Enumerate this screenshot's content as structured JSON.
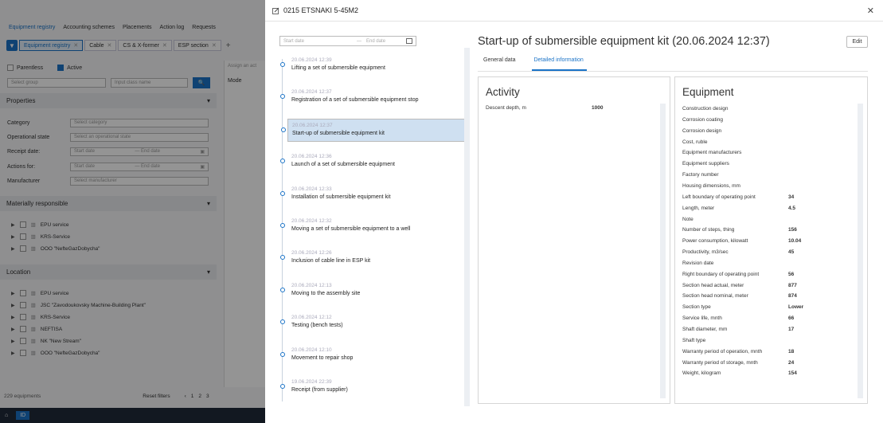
{
  "background": {
    "topnav": [
      "Equipment registry",
      "Accounting schemes",
      "Placements",
      "Action log",
      "Requests"
    ],
    "tabs": [
      {
        "label": "Equipment registry",
        "active": true
      },
      {
        "label": "Cable",
        "active": false
      },
      {
        "label": "CS & X-former",
        "active": false
      },
      {
        "label": "ESP section",
        "active": false
      }
    ],
    "checks": {
      "parentless": "Parentless",
      "active": "Active"
    },
    "select_group_placeholder": "Select group",
    "input_class_placeholder": "Input class name",
    "properties_title": "Properties",
    "props": [
      {
        "label": "Category",
        "placeholder": "Select category"
      },
      {
        "label": "Operational state",
        "placeholder": "Select an operational state"
      },
      {
        "label": "Receipt date:",
        "start": "Start date",
        "end": "End date"
      },
      {
        "label": "Actions for:",
        "start": "Start date",
        "end": "End date"
      },
      {
        "label": "Manufacturer",
        "placeholder": "Select manufacturer"
      }
    ],
    "materially_title": "Materially responsible",
    "materially": [
      "EPU service",
      "KRS-Service",
      "OOO \"NefteGazDobycha\""
    ],
    "location_title": "Location",
    "locations": [
      "EPU service",
      "JSC \"Zavodoukovsky Machine-Building Plant\"",
      "KRS-Service",
      "NEFTISA",
      "NK \"New Stream\"",
      "OOO \"NefteGazDobycha\""
    ],
    "assign_text": "Assign an act",
    "model_header": "Mode",
    "count": "229 equipments",
    "reset": "Reset filters",
    "pages": [
      "1",
      "2",
      "3"
    ],
    "taskbar_id": "ID"
  },
  "modal": {
    "title": "0215 ETSNAKI 5-45M2",
    "close": "✕",
    "date_start_placeholder": "Start date",
    "date_end_placeholder": "End date",
    "events": [
      {
        "date": "20.06.2024 12:39",
        "event": "Lifting a set of submersible equipment",
        "selected": false
      },
      {
        "date": "20.06.2024 12:37",
        "event": "Registration of a set of submersible equipment stop",
        "selected": false
      },
      {
        "date": "20.06.2024 12:37",
        "event": "Start-up of submersible equipment kit",
        "selected": true
      },
      {
        "date": "20.06.2024 12:36",
        "event": "Launch of a set of submersible equipment",
        "selected": false
      },
      {
        "date": "20.06.2024 12:33",
        "event": "Installation of submersible equipment kit",
        "selected": false
      },
      {
        "date": "20.06.2024 12:32",
        "event": "Moving a set of submersible equipment to a well",
        "selected": false
      },
      {
        "date": "20.06.2024 12:26",
        "event": "Inclusion of cable line in ESP kit",
        "selected": false
      },
      {
        "date": "20.06.2024 12:13",
        "event": "Moving to the assembly site",
        "selected": false
      },
      {
        "date": "20.06.2024 12:12",
        "event": "Testing (bench tests)",
        "selected": false
      },
      {
        "date": "20.06.2024 12:10",
        "event": "Movement to repair shop",
        "selected": false
      },
      {
        "date": "19.06.2024 22:39",
        "event": "Receipt (from supplier)",
        "selected": false
      }
    ],
    "detail_title": "Start-up of submersible equipment kit (20.06.2024 12:37)",
    "edit_label": "Edit",
    "tabs": [
      {
        "label": "General data",
        "active": false
      },
      {
        "label": "Detailed information",
        "active": true
      }
    ],
    "activity": {
      "title": "Activity",
      "rows": [
        {
          "label": "Descent depth, m",
          "value": "1000"
        }
      ]
    },
    "equipment": {
      "title": "Equipment",
      "rows": [
        {
          "label": "Construction design",
          "value": ""
        },
        {
          "label": "Corrosion coating",
          "value": ""
        },
        {
          "label": "Corrosion design",
          "value": ""
        },
        {
          "label": "Cost, ruble",
          "value": ""
        },
        {
          "label": "Equipment manufacturers",
          "value": ""
        },
        {
          "label": "Equipment suppliers",
          "value": ""
        },
        {
          "label": "Factory number",
          "value": ""
        },
        {
          "label": "Housing dimensions, mm",
          "value": ""
        },
        {
          "label": "Left boundary of operating point",
          "value": "34"
        },
        {
          "label": "Length, meter",
          "value": "4.5"
        },
        {
          "label": "Note",
          "value": ""
        },
        {
          "label": "Number of steps, thing",
          "value": "156"
        },
        {
          "label": "Power consumption, kilowatt",
          "value": "10.04"
        },
        {
          "label": "Productivity, m3/sec",
          "value": "45"
        },
        {
          "label": "Revision date",
          "value": ""
        },
        {
          "label": "Right boundary of operating point",
          "value": "56"
        },
        {
          "label": "Section head actual, meter",
          "value": "877"
        },
        {
          "label": "Section head nominal, meter",
          "value": "874"
        },
        {
          "label": "Section type",
          "value": "Lower"
        },
        {
          "label": "Service life, mnth",
          "value": "66"
        },
        {
          "label": "Shaft diameter, mm",
          "value": "17"
        },
        {
          "label": "Shaft type",
          "value": ""
        },
        {
          "label": "Warranty period of operation, mnth",
          "value": "18"
        },
        {
          "label": "Warranty period of storage, mnth",
          "value": "24"
        },
        {
          "label": "Weight, kilogram",
          "value": "154"
        }
      ]
    }
  },
  "colors": {
    "accent": "#1a73c7",
    "selected_row": "#cfe0f1"
  }
}
